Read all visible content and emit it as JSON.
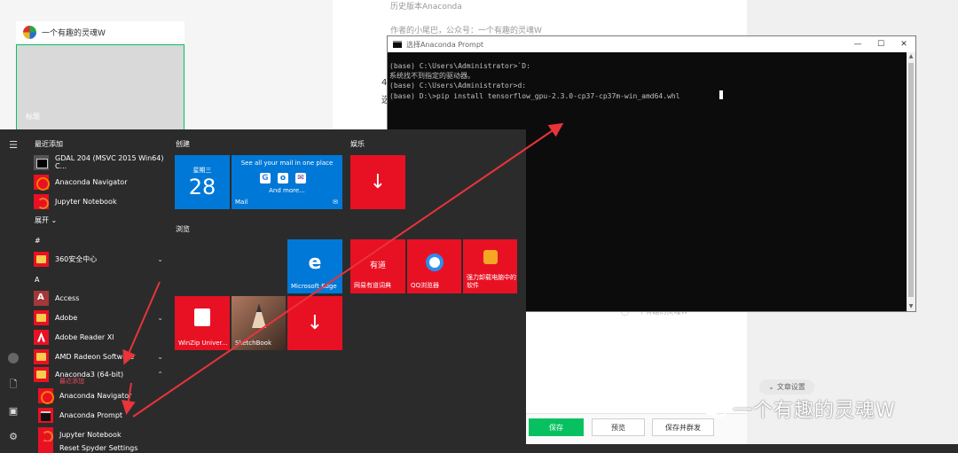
{
  "background": {
    "wechat_account": "一个有趣的灵魂W",
    "cover_label": "标题",
    "doc_line1": "历史版本Anaconda",
    "doc_line2": "作者的小尾巴，公众号：一个有趣的灵魂W",
    "side_num": "4",
    "side_char": "选",
    "faded_text": "一个有趣的灵魂W",
    "article_settings": "文章设置",
    "save": "保存",
    "preview": "预览",
    "save_publish": "保存并群发",
    "watermark": "一个有趣的灵魂W"
  },
  "start_menu": {
    "recent_title": "最近添加",
    "expand_label": "展开",
    "recent": [
      {
        "label": "GDAL 204 (MSVC 2015 Win64) C...",
        "icon": "gdal-icon"
      },
      {
        "label": "Anaconda Navigator",
        "icon": "anaconda-icon"
      },
      {
        "label": "Jupyter Notebook",
        "icon": "jupyter-icon"
      }
    ],
    "hash_section": "#",
    "a_section": "A",
    "apps": [
      {
        "label": "360安全中心",
        "icon": "folder-icon"
      },
      {
        "label": "Access",
        "icon": "access-icon"
      },
      {
        "label": "Adobe",
        "icon": "folder-icon"
      },
      {
        "label": "Adobe Reader XI",
        "icon": "adobe-reader-icon"
      },
      {
        "label": "AMD Radeon Software",
        "icon": "folder-icon"
      },
      {
        "label": "Anaconda3 (64-bit)",
        "sub": "最近添加",
        "icon": "folder-icon"
      },
      {
        "label": "Anaconda Navigator",
        "icon": "anaconda-icon"
      },
      {
        "label": "Anaconda Prompt",
        "icon": "terminal-icon"
      },
      {
        "label": "Jupyter Notebook",
        "icon": "jupyter-icon"
      },
      {
        "label": "Reset Spyder Settings",
        "icon": "spyder-icon"
      }
    ],
    "groups": {
      "create": "创建",
      "entertainment": "娱乐",
      "browse": "浏览"
    },
    "tiles": {
      "calendar_day": "星期三",
      "calendar_date": "28",
      "mail_text": "See all your mail in one place",
      "mail_more": "And more...",
      "mail_label": "Mail",
      "edge_label": "Microsoft Edge",
      "youdao_icon_text": "有道",
      "youdao_label": "网易有道词典",
      "qq_label": "QQ浏览器",
      "uninstall_label": "强力卸载电脑中的软件",
      "winzip_label": "WinZip Univer...",
      "sketch_label": "SketchBook"
    }
  },
  "terminal": {
    "title": "选择Anaconda Prompt",
    "lines": [
      "(base) C:\\Users\\Administrator>`D:",
      "系统找不到指定的驱动器。",
      "",
      "(base) C:\\Users\\Administrator>d:",
      "",
      "(base) D:\\>pip install tensorflow_gpu-2.3.0-cp37-cp37m-win_amd64.whl"
    ]
  },
  "colors": {
    "accent_green": "#07c160",
    "tile_blue": "#0078d7",
    "tile_red": "#e81123",
    "arrow_red": "#e8343a"
  }
}
